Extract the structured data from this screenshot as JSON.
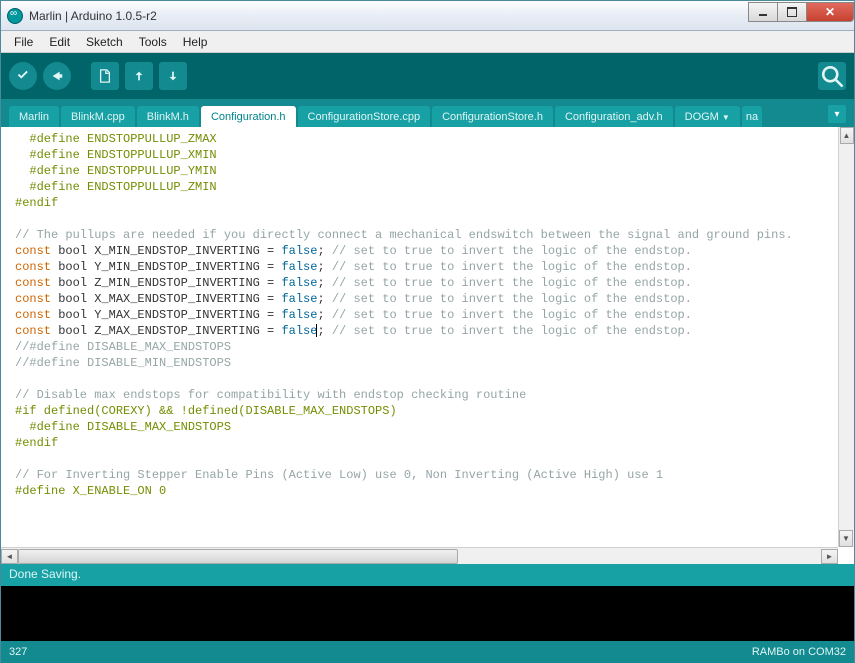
{
  "window": {
    "title": "Marlin | Arduino 1.0.5-r2"
  },
  "menu": {
    "file": "File",
    "edit": "Edit",
    "sketch": "Sketch",
    "tools": "Tools",
    "help": "Help"
  },
  "tabs": [
    {
      "label": "Marlin"
    },
    {
      "label": "BlinkM.cpp"
    },
    {
      "label": "BlinkM.h"
    },
    {
      "label": "Configuration.h",
      "active": true
    },
    {
      "label": "ConfigurationStore.cpp"
    },
    {
      "label": "ConfigurationStore.h"
    },
    {
      "label": "Configuration_adv.h"
    },
    {
      "label": "DOGM"
    },
    {
      "label": "na"
    }
  ],
  "code": {
    "l1": "  #define ENDSTOPPULLUP_ZMAX",
    "l2": "  #define ENDSTOPPULLUP_XMIN",
    "l3": "  #define ENDSTOPPULLUP_YMIN",
    "l4": "  #define ENDSTOPPULLUP_ZMIN",
    "l5": "#endif",
    "l6": "",
    "l7": "// The pullups are needed if you directly connect a mechanical endswitch between the signal and ground pins.",
    "l8a": "const",
    "l8b": " bool X_MIN_ENDSTOP_INVERTING = ",
    "l8c": "false",
    "l8d": "; ",
    "l8e": "// set to true to invert the logic of the endstop.",
    "l9a": "const",
    "l9b": " bool Y_MIN_ENDSTOP_INVERTING = ",
    "l9c": "false",
    "l9d": "; ",
    "l9e": "// set to true to invert the logic of the endstop.",
    "l10a": "const",
    "l10b": " bool Z_MIN_ENDSTOP_INVERTING = ",
    "l10c": "false",
    "l10d": "; ",
    "l10e": "// set to true to invert the logic of the endstop.",
    "l11a": "const",
    "l11b": " bool X_MAX_ENDSTOP_INVERTING = ",
    "l11c": "false",
    "l11d": "; ",
    "l11e": "// set to true to invert the logic of the endstop.",
    "l12a": "const",
    "l12b": " bool Y_MAX_ENDSTOP_INVERTING = ",
    "l12c": "false",
    "l12d": "; ",
    "l12e": "// set to true to invert the logic of the endstop.",
    "l13a": "const",
    "l13b": " bool Z_MAX_ENDSTOP_INVERTING = ",
    "l13c": "false",
    "l13d": "; ",
    "l13e": "// set to true to invert the logic of the endstop.",
    "l14": "//#define DISABLE_MAX_ENDSTOPS",
    "l15": "//#define DISABLE_MIN_ENDSTOPS",
    "l16": "",
    "l17": "// Disable max endstops for compatibility with endstop checking routine",
    "l18": "#if defined(COREXY) && !defined(DISABLE_MAX_ENDSTOPS)",
    "l19": "  #define DISABLE_MAX_ENDSTOPS",
    "l20": "#endif",
    "l21": "",
    "l22": "// For Inverting Stepper Enable Pins (Active Low) use 0, Non Inverting (Active High) use 1",
    "l23": "#define X_ENABLE_ON 0"
  },
  "status": {
    "message": "Done Saving."
  },
  "footer": {
    "line": "327",
    "board": "RAMBo on COM32"
  }
}
